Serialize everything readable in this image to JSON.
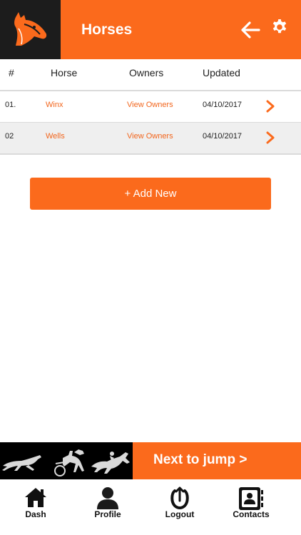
{
  "header": {
    "title": "Horses",
    "logo_icon": "horse-head-logo",
    "back_icon": "arrow-left-icon",
    "settings_icon": "gear-icon"
  },
  "table": {
    "columns": [
      "#",
      "Horse",
      "Owners",
      "Updated"
    ],
    "rows": [
      {
        "num": "01.",
        "horse": "Winx",
        "owners": "View Owners",
        "updated": "04/10/2017"
      },
      {
        "num": "02",
        "horse": "Wells",
        "owners": "View Owners",
        "updated": "04/10/2017"
      }
    ]
  },
  "add_button": "+ Add New",
  "banner": {
    "next_label": "Next to jump >",
    "art_icons": [
      "greyhound-icon",
      "harness-racing-icon",
      "thoroughbred-racing-icon"
    ]
  },
  "tabs": [
    {
      "label": "Dash",
      "icon": "home-icon"
    },
    {
      "label": "Profile",
      "icon": "user-icon"
    },
    {
      "label": "Logout",
      "icon": "horseshoe-logout-icon"
    },
    {
      "label": "Contacts",
      "icon": "contacts-book-icon"
    }
  ],
  "colors": {
    "accent": "#fb6a1c",
    "link": "#f2651c",
    "dark": "#1c1c1c",
    "row_alt": "#efefef"
  }
}
